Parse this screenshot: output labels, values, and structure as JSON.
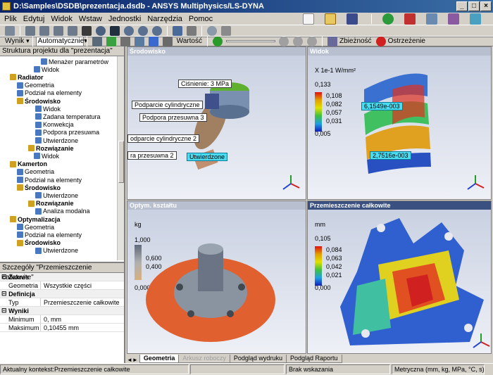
{
  "window": {
    "title": "D:\\Samples\\DSDB\\prezentacja.dsdb - ANSYS Multiphysics/LS-DYNA"
  },
  "menu": [
    "Plik",
    "Edytuj",
    "Widok",
    "Wstaw",
    "Jednostki",
    "Narzędzia",
    "Pomoc"
  ],
  "toolbar2": {
    "result_label": "Wynik",
    "scale_value": "Automatycznie",
    "value_label": "Wartość",
    "convergence_label": "Zbieżność",
    "warning_label": "Ostrzeżenie"
  },
  "tree": {
    "header": "Struktura projektu dla \"prezentacja\"",
    "items": [
      {
        "label": "Menażer parametrów",
        "bold": false
      },
      {
        "label": "Widok",
        "bold": false
      },
      {
        "label": "Radiator",
        "bold": true
      },
      {
        "label": "Geometria",
        "bold": false
      },
      {
        "label": "Podział na elementy",
        "bold": false
      },
      {
        "label": "Środowisko",
        "bold": true
      },
      {
        "label": "Widok",
        "bold": false
      },
      {
        "label": "Zadana temperatura",
        "bold": false
      },
      {
        "label": "Konwekcja",
        "bold": false
      },
      {
        "label": "Podpora przesuwna",
        "bold": false
      },
      {
        "label": "Utwierdzone",
        "bold": false
      },
      {
        "label": "Rozwiązanie",
        "bold": true
      },
      {
        "label": "Widok",
        "bold": false
      },
      {
        "label": "Kamerton",
        "bold": true
      },
      {
        "label": "Geometria",
        "bold": false
      },
      {
        "label": "Podział na elementy",
        "bold": false
      },
      {
        "label": "Środowisko",
        "bold": true
      },
      {
        "label": "Utwierdzone",
        "bold": false
      },
      {
        "label": "Rozwiązanie",
        "bold": true
      },
      {
        "label": "Analiza modalna",
        "bold": false
      },
      {
        "label": "Optymalizacja",
        "bold": true
      },
      {
        "label": "Geometria",
        "bold": false
      },
      {
        "label": "Podział na elementy",
        "bold": false
      },
      {
        "label": "Środowisko",
        "bold": true
      },
      {
        "label": "Utwierdzone",
        "bold": false
      }
    ]
  },
  "details": {
    "header": "Szczegóły \"Przemieszczenie całkowite\"",
    "sections": [
      {
        "title": "Zakres",
        "rows": [
          {
            "k": "Geometria",
            "v": "Wszystkie części"
          }
        ]
      },
      {
        "title": "Definicja",
        "rows": [
          {
            "k": "Typ",
            "v": "Przemieszczenie całkowite"
          }
        ]
      },
      {
        "title": "Wyniki",
        "rows": [
          {
            "k": "Minimum",
            "v": "0, mm"
          },
          {
            "k": "Maksimum",
            "v": "0,10455 mm"
          }
        ]
      }
    ]
  },
  "viewports": {
    "vp1": {
      "title": "Środowisko",
      "callouts": [
        "Ciśnienie: 3 MPa",
        "Podparcie cylindryczne",
        "Podpora przesuwna 3",
        "odparcie cylindryczne 2",
        "ra przesuwna 2",
        "Utwierdzone"
      ]
    },
    "vp2": {
      "title": "Widok",
      "unit": "X 1e-1 W/mm²",
      "max": "0,133",
      "ticks": [
        "0,108",
        "0,082",
        "0,057",
        "0,031"
      ],
      "min": "0,005",
      "probe_hi": "6,1549e-003",
      "probe_lo": "2,7516e-003"
    },
    "vp3": {
      "title": "Optym. kształtu",
      "unit": "kg",
      "ticks": [
        "1,000",
        "0,600",
        "0,400",
        "0,000"
      ]
    },
    "vp4": {
      "title": "Przemieszczenie całkowite",
      "unit": "mm",
      "max": "0,105",
      "ticks": [
        "0,084",
        "0,063",
        "0,042",
        "0,021"
      ],
      "min": "0,000"
    }
  },
  "tabs": [
    "Geometria",
    "Arkusz roboczy",
    "Podgląd wydruku",
    "Podgląd Raportu"
  ],
  "status": {
    "context": "Aktualny kontekst:Przemieszczenie całkowite",
    "selection": "Brak wskazania",
    "units": "Metryczna (mm, kg, MPa, °C, s)"
  },
  "colors": {
    "titlebar": "#0a246a",
    "chrome": "#d4d0c8"
  }
}
